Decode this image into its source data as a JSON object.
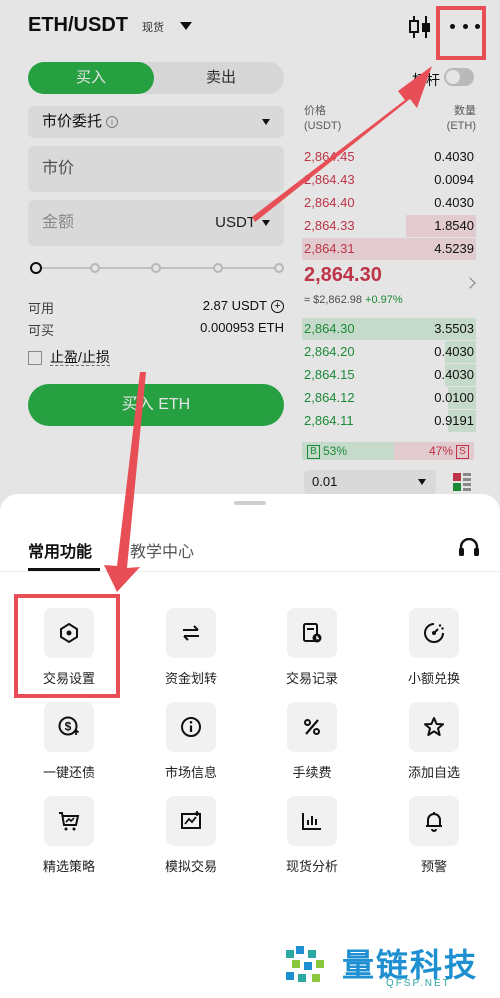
{
  "header": {
    "pair": "ETH/USDT",
    "spot_badge": "现货",
    "leverage_label": "杠杆"
  },
  "trade": {
    "buy_tab": "买入",
    "sell_tab": "卖出",
    "order_type": "市价委托",
    "price_field": "市价",
    "amount_placeholder": "金额",
    "amount_unit": "USDT",
    "slider_percent": 0,
    "available_label": "可用",
    "available_value": "2.87 USDT",
    "can_buy_label": "可买",
    "can_buy_value": "0.000953 ETH",
    "tpsl_label": "止盈/止损",
    "buy_button": "买入 ETH"
  },
  "orderbook": {
    "price_header": "价格",
    "price_unit": "(USDT)",
    "qty_header": "数量",
    "qty_unit": "(ETH)",
    "asks": [
      {
        "price": "2,864.45",
        "qty": "0.4030",
        "depth": 0
      },
      {
        "price": "2,864.43",
        "qty": "0.0094",
        "depth": 0
      },
      {
        "price": "2,864.40",
        "qty": "0.4030",
        "depth": 0
      },
      {
        "price": "2,864.33",
        "qty": "1.8540",
        "depth": 0.4
      },
      {
        "price": "2,864.31",
        "qty": "4.5239",
        "depth": 1.0
      }
    ],
    "last_price": "2,864.30",
    "last_usd": "≈ $2,862.98",
    "last_change": "+0.97%",
    "bids": [
      {
        "price": "2,864.30",
        "qty": "3.5503",
        "depth": 1.0
      },
      {
        "price": "2,864.20",
        "qty": "0.4030",
        "depth": 0.18
      },
      {
        "price": "2,864.15",
        "qty": "0.4030",
        "depth": 0.18
      },
      {
        "price": "2,864.12",
        "qty": "0.0100",
        "depth": 0.16
      },
      {
        "price": "2,864.11",
        "qty": "0.9191",
        "depth": 0.16
      }
    ],
    "buy_ratio_tag": "B",
    "buy_ratio": "53%",
    "sell_ratio_tag": "S",
    "sell_ratio": "47%",
    "depth_step": "0.01"
  },
  "sheet": {
    "tab_common": "常用功能",
    "tab_learn": "教学中心",
    "tools": [
      {
        "label": "交易设置",
        "icon": "hexagon-settings-icon"
      },
      {
        "label": "资金划转",
        "icon": "transfer-arrows-icon"
      },
      {
        "label": "交易记录",
        "icon": "trade-record-icon"
      },
      {
        "label": "小额兑换",
        "icon": "small-exchange-icon"
      },
      {
        "label": "一键还债",
        "icon": "repay-debt-icon"
      },
      {
        "label": "市场信息",
        "icon": "info-icon"
      },
      {
        "label": "手续费",
        "icon": "percent-icon"
      },
      {
        "label": "添加自选",
        "icon": "star-icon"
      },
      {
        "label": "精选策略",
        "icon": "strategy-cart-icon"
      },
      {
        "label": "模拟交易",
        "icon": "demo-trade-icon"
      },
      {
        "label": "现货分析",
        "icon": "bar-chart-icon"
      },
      {
        "label": "预警",
        "icon": "bell-icon"
      }
    ]
  },
  "watermark": {
    "title": "量链科技",
    "domain": "QFSP.NET"
  },
  "colors": {
    "buy": "#2cb34a",
    "ask": "#d23a4f",
    "bid": "#1f9a3e",
    "annotation": "#e84e55"
  }
}
